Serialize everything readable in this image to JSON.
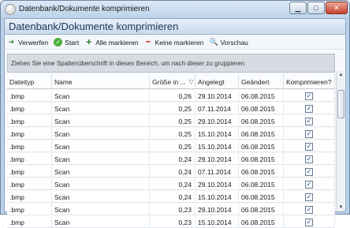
{
  "window": {
    "title": "Datenbank/Dokumente komprimieren",
    "icons": {
      "app": "app-orb-icon",
      "minimize": "minimize-icon",
      "maximize": "maximize-icon",
      "close": "close-icon"
    }
  },
  "header": {
    "title": "Datenbank/Dokumente komprimieren"
  },
  "toolbar": {
    "discard_label": "Verwerfen",
    "start_label": "Start",
    "select_all_label": "Alle markieren",
    "select_none_label": "Keine markieren",
    "preview_label": "Vorschau",
    "icons": [
      "discard-icon",
      "start-icon",
      "select-all-icon",
      "select-none-icon",
      "preview-icon"
    ]
  },
  "group_panel": {
    "text": "Ziehen Sie eine Spaltenüberschrift in diesen Bereich, um nach dieser zu gruppieren"
  },
  "grid": {
    "columns": [
      "Dateityp",
      "Name",
      "Größe in ...",
      "Angelegt",
      "Geändert",
      "Komprimieren?"
    ],
    "rows": [
      {
        "type": ".bmp",
        "name": "Scan",
        "size": "0,26",
        "created": "29.10.2014",
        "changed": "06.08.2015",
        "compress": true
      },
      {
        "type": ".bmp",
        "name": "Scan",
        "size": "0,25",
        "created": "07.11.2014",
        "changed": "06.08.2015",
        "compress": true
      },
      {
        "type": ".bmp",
        "name": "Scan",
        "size": "0,25",
        "created": "29.10.2014",
        "changed": "06.08.2015",
        "compress": true
      },
      {
        "type": ".bmp",
        "name": "Scan",
        "size": "0,25",
        "created": "15.10.2014",
        "changed": "06.08.2015",
        "compress": true
      },
      {
        "type": ".bmp",
        "name": "Scan",
        "size": "0,25",
        "created": "15.10.2014",
        "changed": "06.08.2015",
        "compress": true
      },
      {
        "type": ".bmp",
        "name": "Scan",
        "size": "0,24",
        "created": "29.10.2014",
        "changed": "06.08.2015",
        "compress": true
      },
      {
        "type": ".bmp",
        "name": "Scan",
        "size": "0,24",
        "created": "07.11.2014",
        "changed": "06.08.2015",
        "compress": true
      },
      {
        "type": ".bmp",
        "name": "Scan",
        "size": "0,24",
        "created": "29.10.2014",
        "changed": "06.08.2015",
        "compress": true
      },
      {
        "type": ".bmp",
        "name": "Scan",
        "size": "0,24",
        "created": "15.10.2014",
        "changed": "06.08.2015",
        "compress": true
      },
      {
        "type": ".bmp",
        "name": "Scan",
        "size": "0,23",
        "created": "29.10.2014",
        "changed": "06.08.2015",
        "compress": true
      },
      {
        "type": ".bmp",
        "name": "Scan",
        "size": "0,23",
        "created": "15.10.2014",
        "changed": "06.08.2015",
        "compress": true
      }
    ]
  },
  "colors": {
    "header_text": "#233b5c",
    "window_frame": "#b9d1ea",
    "accent_green": "#4caf3e",
    "accent_red": "#d0301e"
  }
}
